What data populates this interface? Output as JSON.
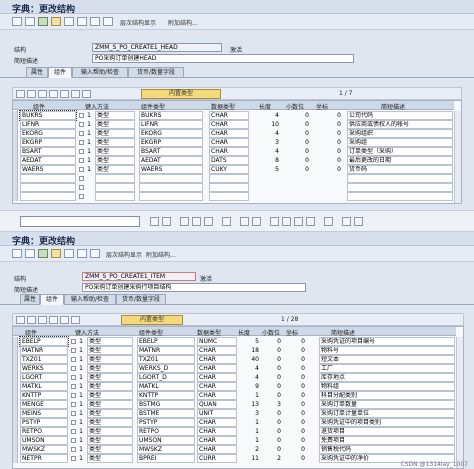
{
  "screen1": {
    "title": "字典：更改结构",
    "toolbar": {
      "hierarchy": "层次结构显示",
      "append": "附加结构..."
    },
    "struct_label": "结构",
    "struct_name": "ZMM_S_PO_CREATE1_HEAD",
    "status": "激活",
    "desc_label": "简短描述",
    "desc_value": "PO采购订单创建HEAD",
    "tabs": [
      "属性",
      "组件",
      "输入帮助/检查",
      "货币/数量字段"
    ],
    "predefined": "内置类型",
    "page": "1 / 7",
    "headers": [
      "组件",
      "键入方法",
      "组件类型",
      "数据类型",
      "长度",
      "小数位",
      "坐标",
      "简短描述"
    ],
    "rows": [
      [
        "BUKRS",
        "1",
        "类型",
        "BUKRS",
        "CHAR",
        "4",
        "0",
        "0",
        "公司代码"
      ],
      [
        "LIFNR",
        "1",
        "类型",
        "LIFNR",
        "CHAR",
        "10",
        "0",
        "0",
        "供应商或债权人的帐号"
      ],
      [
        "EKORG",
        "1",
        "类型",
        "EKORG",
        "CHAR",
        "4",
        "0",
        "0",
        "采购组织"
      ],
      [
        "EKGRP",
        "1",
        "类型",
        "EKGRP",
        "CHAR",
        "3",
        "0",
        "0",
        "采购组"
      ],
      [
        "BSART",
        "1",
        "类型",
        "BSART",
        "CHAR",
        "4",
        "0",
        "0",
        "订单类型（采购）"
      ],
      [
        "AEDAT",
        "1",
        "类型",
        "AEDAT",
        "DATS",
        "8",
        "0",
        "0",
        "最后更改的日期"
      ],
      [
        "WAERS",
        "1",
        "类型",
        "WAERS",
        "CUKY",
        "5",
        "0",
        "0",
        "货币码"
      ]
    ]
  },
  "screen2": {
    "title": "字典：更改结构",
    "toolbar": {
      "hierarchy": "层次结构显示",
      "append": "附加结构..."
    },
    "struct_label": "结构",
    "struct_name": "ZMM_S_PO_CREATE1_ITEM",
    "status": "激活",
    "desc_label": "简短描述",
    "desc_value": "PO采购订单创建采购行项目结构",
    "tabs": [
      "属性",
      "组件",
      "输入帮助/检查",
      "货币/数量字段"
    ],
    "predefined": "内置类型",
    "page": "1 / 28",
    "headers": [
      "组件",
      "键入方法",
      "组件类型",
      "数据类型",
      "长度",
      "小数位",
      "坐标",
      "简短描述"
    ],
    "rows": [
      [
        "EBELP",
        "1",
        "类型",
        "EBELP",
        "NUMC",
        "5",
        "0",
        "0",
        "采购凭证的项目编号"
      ],
      [
        "MATNR",
        "1",
        "类型",
        "MATNR",
        "CHAR",
        "18",
        "0",
        "0",
        "物料号"
      ],
      [
        "TXZ01",
        "1",
        "类型",
        "TXZ01",
        "CHAR",
        "40",
        "0",
        "0",
        "短文本"
      ],
      [
        "WERKS",
        "1",
        "类型",
        "WERKS_D",
        "CHAR",
        "4",
        "0",
        "0",
        "工厂"
      ],
      [
        "LGORT",
        "1",
        "类型",
        "LGORT_D",
        "CHAR",
        "4",
        "0",
        "0",
        "库存地点"
      ],
      [
        "MATKL",
        "1",
        "类型",
        "MATKL",
        "CHAR",
        "9",
        "0",
        "0",
        "物料组"
      ],
      [
        "KNTTP",
        "1",
        "类型",
        "KNTTP",
        "CHAR",
        "1",
        "0",
        "0",
        "科目分配类别"
      ],
      [
        "MENGE",
        "1",
        "类型",
        "BSTMG",
        "QUAN",
        "13",
        "3",
        "0",
        "采购订单数量"
      ],
      [
        "MEINS",
        "1",
        "类型",
        "BSTME",
        "UNIT",
        "3",
        "0",
        "0",
        "采购订单计量单位"
      ],
      [
        "PSTYP",
        "1",
        "类型",
        "PSTYP",
        "CHAR",
        "1",
        "0",
        "0",
        "采购凭证中的项目类别"
      ],
      [
        "RETPO",
        "1",
        "类型",
        "RETPO",
        "CHAR",
        "1",
        "0",
        "0",
        "退货项目"
      ],
      [
        "UMSON",
        "1",
        "类型",
        "UMSON",
        "CHAR",
        "1",
        "0",
        "0",
        "免费项目"
      ],
      [
        "MWSKZ",
        "1",
        "类型",
        "MWSKZ",
        "CHAR",
        "2",
        "0",
        "0",
        "销售税代码"
      ],
      [
        "NETPR",
        "1",
        "类型",
        "BPREI",
        "CURR",
        "11",
        "2",
        "0",
        "采购凭证中的净价"
      ]
    ]
  },
  "watermark": "CSDN @1314lay_1007"
}
